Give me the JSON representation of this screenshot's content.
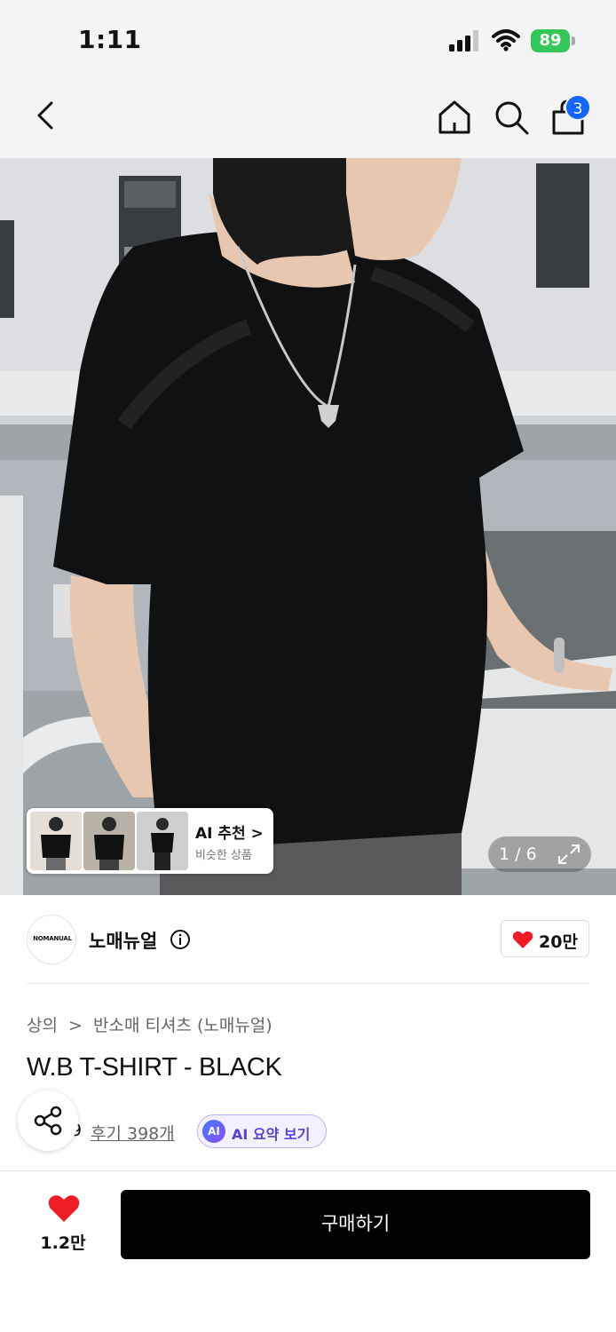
{
  "status_bar": {
    "time": "1:11",
    "battery": "89"
  },
  "nav": {
    "back_icon": "chevron-left-icon",
    "home_icon": "home-icon",
    "search_icon": "search-icon",
    "bag_icon": "shopping-bag-icon",
    "bag_badge": "3",
    "badge_color": "#1565ff"
  },
  "hero": {
    "counter": "1 / 6",
    "ai_recommend": {
      "title": "AI 추천 >",
      "subtitle": "비슷한 상품"
    }
  },
  "brand": {
    "logo_text": "NOMANUAL",
    "name": "노매뉴얼",
    "likes": "20만",
    "heart_color": "#ee1c25"
  },
  "product": {
    "breadcrumb": [
      "상의",
      "반소매 티셔츠 (노매뉴얼)"
    ],
    "breadcrumb_sep": ">",
    "title": "W.B T-SHIRT - BLACK",
    "rating_partial": "9",
    "reviews": "후기 398개",
    "ai_summary_badge": "AI",
    "ai_summary_label": "AI 요약 보기"
  },
  "bottom_bar": {
    "wish_count": "1.2만",
    "buy_label": "구매하기"
  }
}
